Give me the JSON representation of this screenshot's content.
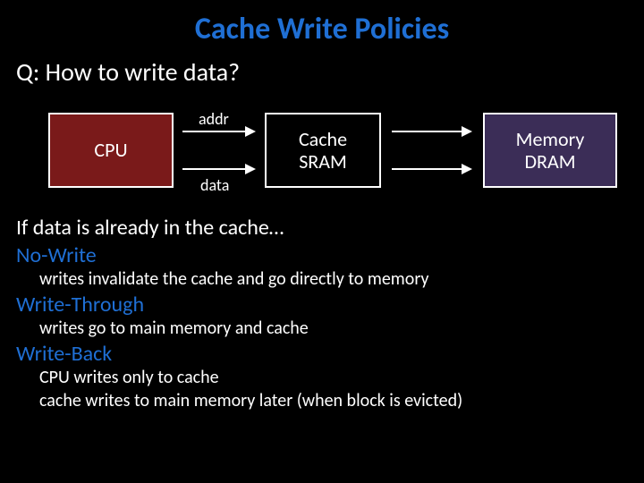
{
  "title": "Cache Write Policies",
  "question": "Q: How to write data?",
  "diagram": {
    "cpu": "CPU",
    "cache_line1": "Cache",
    "cache_line2": "SRAM",
    "mem_line1": "Memory",
    "mem_line2": "DRAM",
    "addr_label": "addr",
    "data_label": "data"
  },
  "lead": "If data is already in the cache…",
  "policies": [
    {
      "name": "No-Write",
      "desc": [
        "writes invalidate the cache and go directly to memory"
      ]
    },
    {
      "name": "Write-Through",
      "desc": [
        "writes go to main memory and cache"
      ]
    },
    {
      "name": "Write-Back",
      "desc": [
        "CPU writes only to cache",
        "cache writes to main memory later (when block is evicted)"
      ]
    }
  ]
}
